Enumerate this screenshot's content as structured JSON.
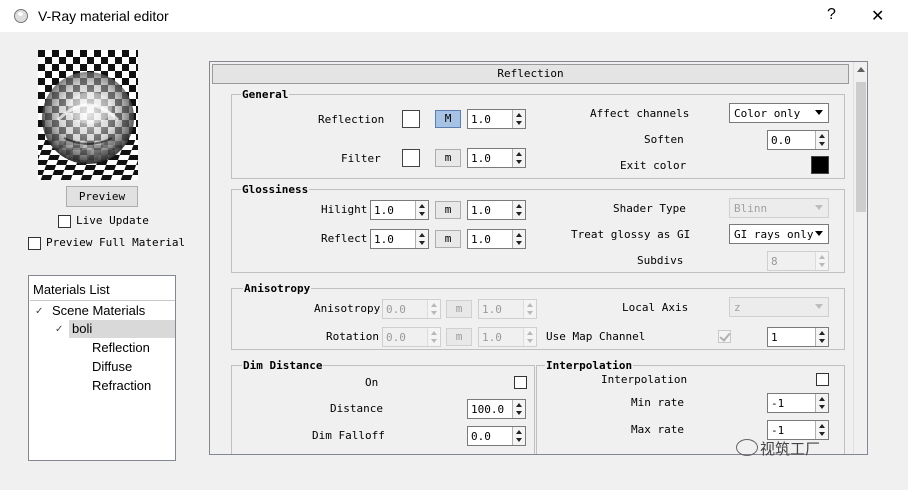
{
  "window": {
    "title": "V-Ray material editor",
    "help_label": "?",
    "close_label": "✕"
  },
  "left": {
    "preview_button": "Preview",
    "live_update": "Live Update",
    "preview_full": "Preview Full Material"
  },
  "materials": {
    "title": "Materials List",
    "scene": "Scene Materials",
    "selected": "boli",
    "children": [
      "Reflection",
      "Diffuse",
      "Refraction"
    ]
  },
  "panel": {
    "header": "Reflection",
    "general": {
      "title": "General",
      "reflection_label": "Reflection",
      "reflection_m": "M",
      "reflection_value": "1.0",
      "filter_label": "Filter",
      "filter_m": "m",
      "filter_value": "1.0",
      "affect_label": "Affect channels",
      "affect_value": "Color only",
      "soften_label": "Soften",
      "soften_value": "0.0",
      "exit_label": "Exit color",
      "exit_color": "#000000"
    },
    "glossiness": {
      "title": "Glossiness",
      "hilight_label": "Hilight",
      "hilight_value": "1.0",
      "hilight_m": "m",
      "hilight_value2": "1.0",
      "reflect_label": "Reflect",
      "reflect_value": "1.0",
      "reflect_m": "m",
      "reflect_value2": "1.0",
      "shader_label": "Shader Type",
      "shader_value": "Blinn",
      "treat_label": "Treat glossy as GI",
      "treat_value": "GI rays only",
      "subdivs_label": "Subdivs",
      "subdivs_value": "8"
    },
    "anisotropy": {
      "title": "Anisotropy",
      "anisotropy_label": "Anisotropy",
      "anisotropy_value": "0.0",
      "anisotropy_m": "m",
      "anisotropy_value2": "1.0",
      "rotation_label": "Rotation",
      "rotation_value": "0.0",
      "rotation_m": "m",
      "rotation_value2": "1.0",
      "local_axis_label": "Local Axis",
      "local_axis_value": "z",
      "map_channel_label": "Use Map Channel",
      "map_channel_value": "1"
    },
    "dim": {
      "title": "Dim Distance",
      "on_label": "On",
      "distance_label": "Distance",
      "distance_value": "100.0",
      "falloff_label": "Dim Falloff",
      "falloff_value": "0.0"
    },
    "interp": {
      "title": "Interpolation",
      "interp_label": "Interpolation",
      "min_label": "Min rate",
      "min_value": "-1",
      "max_label": "Max rate",
      "max_value": "-1"
    }
  },
  "watermark": "视筑工厂"
}
